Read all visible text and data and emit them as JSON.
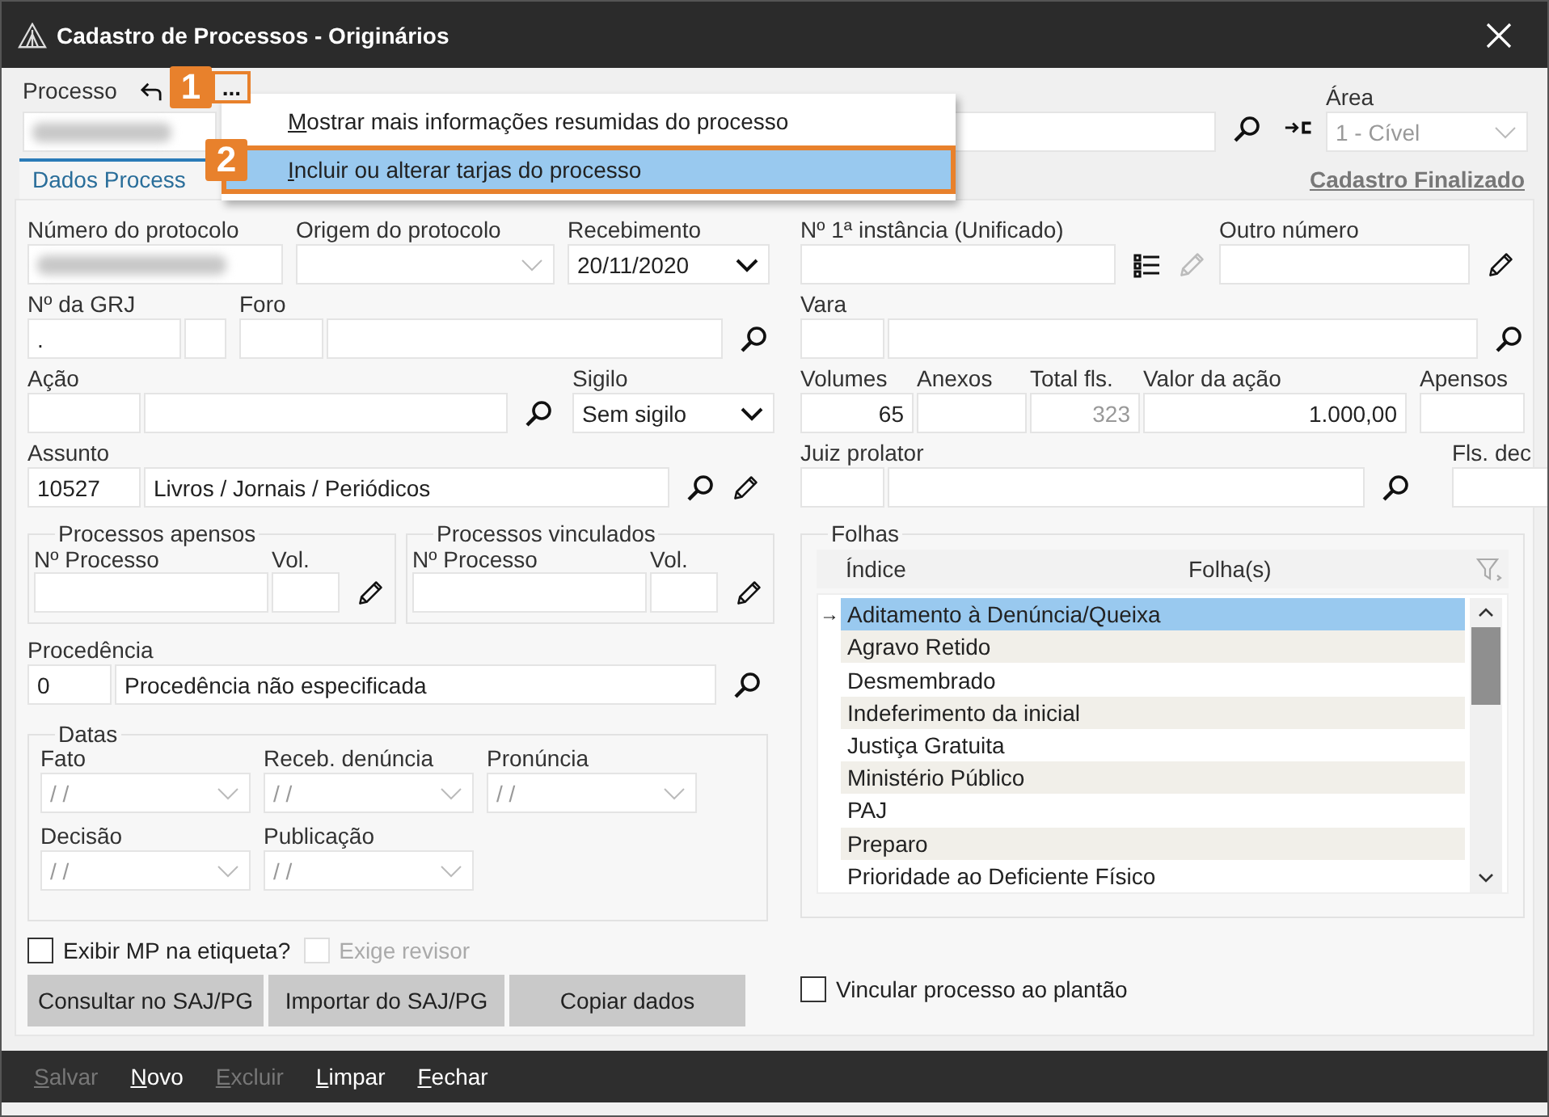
{
  "window": {
    "title": "Cadastro de Processos - Originários"
  },
  "header": {
    "process_label": "Processo",
    "process_redacted": true,
    "more_button": "...",
    "more_highlighted": true,
    "area_label": "Área",
    "area_value": "1 - Cível",
    "area_disabled": true,
    "status_link": "Cadastro Finalizado"
  },
  "tab": {
    "label": "Dados Process",
    "selected": true
  },
  "menu": {
    "items": [
      {
        "label": "Mostrar mais informações resumidas do processo",
        "selected": false,
        "highlighted": false,
        "underline_first": true
      },
      {
        "label": "Incluir ou alterar tarjas do processo",
        "selected": true,
        "highlighted": true,
        "underline_first": true
      }
    ]
  },
  "callouts": [
    {
      "number": "1"
    },
    {
      "number": "2"
    }
  ],
  "protocolo": {
    "label": "Número do protocolo",
    "redacted": true
  },
  "origem": {
    "label": "Origem do protocolo",
    "disabled": true
  },
  "recebimento": {
    "label": "Recebimento",
    "value": "20/11/2020"
  },
  "grj": {
    "label": "Nº da GRJ",
    "value": "."
  },
  "foro": {
    "label": "Foro"
  },
  "acao": {
    "label": "Ação"
  },
  "sigilo": {
    "label": "Sigilo",
    "value": "Sem sigilo"
  },
  "assunto": {
    "label": "Assunto",
    "code": "10527",
    "value": "Livros / Jornais / Periódicos"
  },
  "apensos_group": {
    "title": "Processos apensos",
    "number_label": "Nº Processo",
    "vol_label": "Vol."
  },
  "vinculados_group": {
    "title": "Processos vinculados",
    "number_label": "Nº Processo",
    "vol_label": "Vol."
  },
  "procedencia": {
    "label": "Procedência",
    "code": "0",
    "value": "Procedência não especificada"
  },
  "datas": {
    "title": "Datas",
    "fields": [
      {
        "label": "Fato",
        "value": "/ /",
        "disabled": true
      },
      {
        "label": "Receb. denúncia",
        "value": "/ /",
        "disabled": true
      },
      {
        "label": "Pronúncia",
        "value": "/ /",
        "disabled": true
      },
      {
        "label": "Decisão",
        "value": "/ /",
        "disabled": true
      },
      {
        "label": "Publicação",
        "value": "/ /",
        "disabled": true
      }
    ]
  },
  "checks": [
    {
      "label": "Exibir MP na etiqueta?",
      "checked": false,
      "disabled": false
    },
    {
      "label": "Exige revisor",
      "checked": false,
      "disabled": true
    }
  ],
  "actions": [
    "Consultar no SAJ/PG",
    "Importar do SAJ/PG",
    "Copiar dados"
  ],
  "instancia": {
    "label": "Nº 1ª instância (Unificado)",
    "edit_disabled": true
  },
  "outro_numero": {
    "label": "Outro número"
  },
  "vara": {
    "label": "Vara"
  },
  "volumes": {
    "label": "Volumes",
    "value": "65"
  },
  "anexos": {
    "label": "Anexos"
  },
  "total_fls": {
    "label": "Total fls.",
    "value": "323",
    "disabled": true
  },
  "valor": {
    "label": "Valor da ação",
    "value": "1.000,00"
  },
  "apensos": {
    "label": "Apensos"
  },
  "juiz": {
    "label": "Juiz prolator"
  },
  "fls_dec": {
    "label": "Fls. dec"
  },
  "folhas": {
    "title": "Folhas",
    "columns": [
      "Índice",
      "Folha(s)"
    ],
    "rows": [
      {
        "label": "Aditamento à Denúncia/Queixa",
        "marker": "→",
        "selected": true
      },
      {
        "label": "Agravo Retido",
        "selected": false
      },
      {
        "label": "Desmembrado",
        "selected": false
      },
      {
        "label": "Indeferimento da inicial",
        "selected": false
      },
      {
        "label": "Justiça Gratuita",
        "selected": false
      },
      {
        "label": "Ministério Público",
        "selected": false
      },
      {
        "label": "PAJ",
        "selected": false
      },
      {
        "label": "Preparo",
        "selected": false
      },
      {
        "label": "Prioridade ao Deficiente Físico",
        "selected": false
      }
    ]
  },
  "plantao": {
    "label": "Vincular processo ao plantão",
    "checked": false
  },
  "footer": [
    {
      "label": "Salvar",
      "disabled": true,
      "underline_first": true
    },
    {
      "label": "Novo",
      "disabled": false,
      "underline_first": true
    },
    {
      "label": "Excluir",
      "disabled": true,
      "underline_first": true
    },
    {
      "label": "Limpar",
      "disabled": false,
      "underline_first": true
    },
    {
      "label": "Fechar",
      "disabled": false,
      "underline_first": true
    }
  ]
}
